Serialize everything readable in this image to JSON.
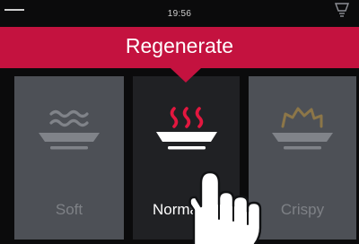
{
  "status": {
    "time": "19:56"
  },
  "header": {
    "title": "Regenerate"
  },
  "options": [
    {
      "label": "Soft",
      "icon": "waves-plate-icon",
      "selected": false
    },
    {
      "label": "Normal",
      "icon": "steam-plate-icon",
      "selected": true
    },
    {
      "label": "Crispy",
      "icon": "crispy-plate-icon",
      "selected": false
    }
  ],
  "colors": {
    "accent": "#c4123f",
    "tile_inactive": "#4d5056",
    "tile_active": "#202124",
    "background": "#0b0b0c"
  }
}
